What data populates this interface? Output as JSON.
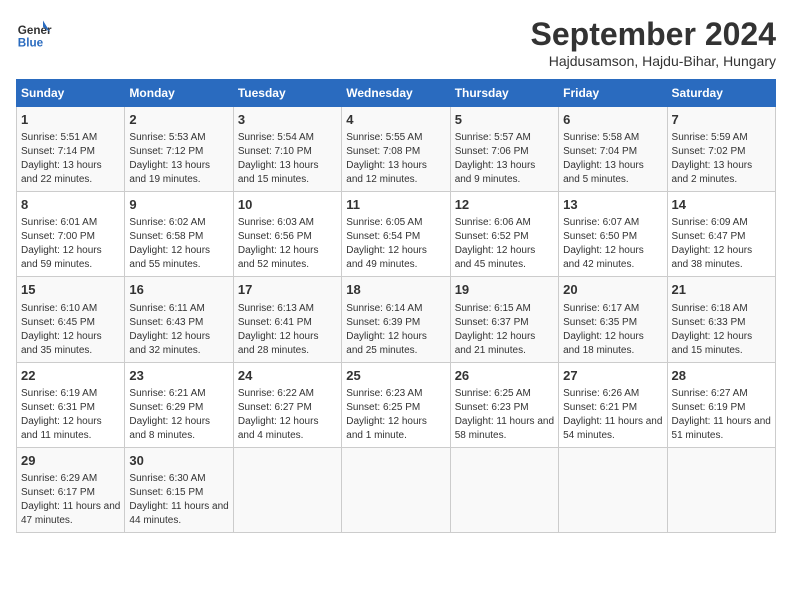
{
  "header": {
    "logo_line1": "General",
    "logo_line2": "Blue",
    "month": "September 2024",
    "location": "Hajdusamson, Hajdu-Bihar, Hungary"
  },
  "weekdays": [
    "Sunday",
    "Monday",
    "Tuesday",
    "Wednesday",
    "Thursday",
    "Friday",
    "Saturday"
  ],
  "weeks": [
    [
      {
        "day": "1",
        "info": "Sunrise: 5:51 AM\nSunset: 7:14 PM\nDaylight: 13 hours and 22 minutes."
      },
      {
        "day": "2",
        "info": "Sunrise: 5:53 AM\nSunset: 7:12 PM\nDaylight: 13 hours and 19 minutes."
      },
      {
        "day": "3",
        "info": "Sunrise: 5:54 AM\nSunset: 7:10 PM\nDaylight: 13 hours and 15 minutes."
      },
      {
        "day": "4",
        "info": "Sunrise: 5:55 AM\nSunset: 7:08 PM\nDaylight: 13 hours and 12 minutes."
      },
      {
        "day": "5",
        "info": "Sunrise: 5:57 AM\nSunset: 7:06 PM\nDaylight: 13 hours and 9 minutes."
      },
      {
        "day": "6",
        "info": "Sunrise: 5:58 AM\nSunset: 7:04 PM\nDaylight: 13 hours and 5 minutes."
      },
      {
        "day": "7",
        "info": "Sunrise: 5:59 AM\nSunset: 7:02 PM\nDaylight: 13 hours and 2 minutes."
      }
    ],
    [
      {
        "day": "8",
        "info": "Sunrise: 6:01 AM\nSunset: 7:00 PM\nDaylight: 12 hours and 59 minutes."
      },
      {
        "day": "9",
        "info": "Sunrise: 6:02 AM\nSunset: 6:58 PM\nDaylight: 12 hours and 55 minutes."
      },
      {
        "day": "10",
        "info": "Sunrise: 6:03 AM\nSunset: 6:56 PM\nDaylight: 12 hours and 52 minutes."
      },
      {
        "day": "11",
        "info": "Sunrise: 6:05 AM\nSunset: 6:54 PM\nDaylight: 12 hours and 49 minutes."
      },
      {
        "day": "12",
        "info": "Sunrise: 6:06 AM\nSunset: 6:52 PM\nDaylight: 12 hours and 45 minutes."
      },
      {
        "day": "13",
        "info": "Sunrise: 6:07 AM\nSunset: 6:50 PM\nDaylight: 12 hours and 42 minutes."
      },
      {
        "day": "14",
        "info": "Sunrise: 6:09 AM\nSunset: 6:47 PM\nDaylight: 12 hours and 38 minutes."
      }
    ],
    [
      {
        "day": "15",
        "info": "Sunrise: 6:10 AM\nSunset: 6:45 PM\nDaylight: 12 hours and 35 minutes."
      },
      {
        "day": "16",
        "info": "Sunrise: 6:11 AM\nSunset: 6:43 PM\nDaylight: 12 hours and 32 minutes."
      },
      {
        "day": "17",
        "info": "Sunrise: 6:13 AM\nSunset: 6:41 PM\nDaylight: 12 hours and 28 minutes."
      },
      {
        "day": "18",
        "info": "Sunrise: 6:14 AM\nSunset: 6:39 PM\nDaylight: 12 hours and 25 minutes."
      },
      {
        "day": "19",
        "info": "Sunrise: 6:15 AM\nSunset: 6:37 PM\nDaylight: 12 hours and 21 minutes."
      },
      {
        "day": "20",
        "info": "Sunrise: 6:17 AM\nSunset: 6:35 PM\nDaylight: 12 hours and 18 minutes."
      },
      {
        "day": "21",
        "info": "Sunrise: 6:18 AM\nSunset: 6:33 PM\nDaylight: 12 hours and 15 minutes."
      }
    ],
    [
      {
        "day": "22",
        "info": "Sunrise: 6:19 AM\nSunset: 6:31 PM\nDaylight: 12 hours and 11 minutes."
      },
      {
        "day": "23",
        "info": "Sunrise: 6:21 AM\nSunset: 6:29 PM\nDaylight: 12 hours and 8 minutes."
      },
      {
        "day": "24",
        "info": "Sunrise: 6:22 AM\nSunset: 6:27 PM\nDaylight: 12 hours and 4 minutes."
      },
      {
        "day": "25",
        "info": "Sunrise: 6:23 AM\nSunset: 6:25 PM\nDaylight: 12 hours and 1 minute."
      },
      {
        "day": "26",
        "info": "Sunrise: 6:25 AM\nSunset: 6:23 PM\nDaylight: 11 hours and 58 minutes."
      },
      {
        "day": "27",
        "info": "Sunrise: 6:26 AM\nSunset: 6:21 PM\nDaylight: 11 hours and 54 minutes."
      },
      {
        "day": "28",
        "info": "Sunrise: 6:27 AM\nSunset: 6:19 PM\nDaylight: 11 hours and 51 minutes."
      }
    ],
    [
      {
        "day": "29",
        "info": "Sunrise: 6:29 AM\nSunset: 6:17 PM\nDaylight: 11 hours and 47 minutes."
      },
      {
        "day": "30",
        "info": "Sunrise: 6:30 AM\nSunset: 6:15 PM\nDaylight: 11 hours and 44 minutes."
      },
      {
        "day": "",
        "info": ""
      },
      {
        "day": "",
        "info": ""
      },
      {
        "day": "",
        "info": ""
      },
      {
        "day": "",
        "info": ""
      },
      {
        "day": "",
        "info": ""
      }
    ]
  ]
}
